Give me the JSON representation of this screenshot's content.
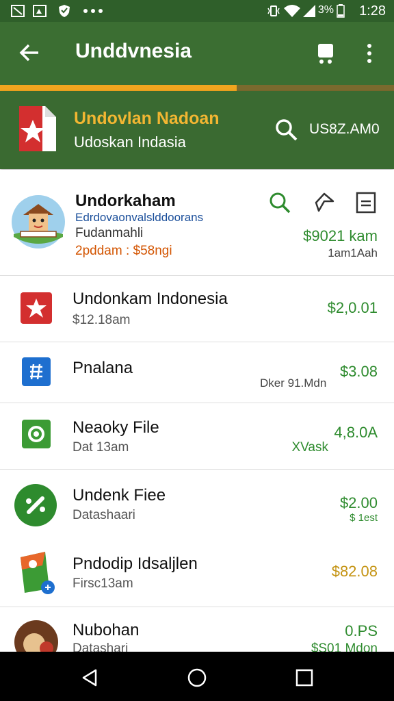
{
  "status_bar": {
    "battery_percent": "3%",
    "time": "1:28"
  },
  "app_bar": {
    "title": "Unddvnesia",
    "progress_fraction": 0.6
  },
  "banner": {
    "title": "Undovlan Nadoan",
    "subtitle": "Udoskan Indasia",
    "amount": "US8Z.AM0"
  },
  "featured": {
    "title": "Undorkaham",
    "link": "Edrdovaonvalslddoorans",
    "line2": "Fudanmahli",
    "line3": "2pddam : $58ngi",
    "amount": "$9021 kam",
    "note": "1am1Aah"
  },
  "items": [
    {
      "title": "Undonkam Indonesia",
      "sub": "$12.18am",
      "amount": "$2,0.01",
      "note": "",
      "icon": "star-icon",
      "color": "#d32f2f"
    },
    {
      "title": "Pnalana",
      "sub": "",
      "amount": "$3.08",
      "note": "Dker 91.Mdn",
      "icon": "grid-icon",
      "color": "#1e6fcf"
    },
    {
      "title": "Neaoky File",
      "sub": "Dat 13am",
      "amount": "4,8.0A",
      "note": "XVask",
      "icon": "camera-icon",
      "color": "#3c9b35"
    },
    {
      "title": "Undenk Fiee",
      "sub": "Datashaari",
      "amount": "$2.00",
      "note": "$ 1est",
      "icon": "percent-icon",
      "color": "#2e8b2e"
    },
    {
      "title": "Pndodip Idsaljlen",
      "sub": "Firsc13am",
      "amount": "$82.08",
      "note": "",
      "icon": "flag-icon",
      "color": "#c49312"
    },
    {
      "title": "Nubohan",
      "sub": "Datashari",
      "amount": "0.PS",
      "note": "$S01 Mdon",
      "icon": "avatar-icon",
      "color": "#2e8b2e"
    }
  ]
}
